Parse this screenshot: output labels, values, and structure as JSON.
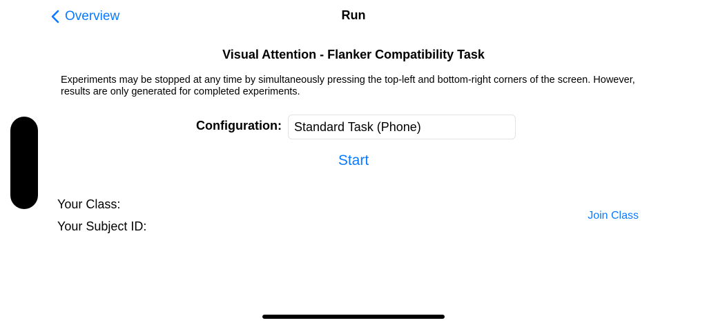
{
  "nav": {
    "back_label": "Overview",
    "title": "Run"
  },
  "task": {
    "title": "Visual Attention - Flanker Compatibility Task",
    "description": "Experiments may be stopped at any time by simultaneously pressing the top-left and bottom-right corners of the screen. However, results are only generated for completed experiments."
  },
  "configuration": {
    "label": "Configuration:",
    "value": "Standard Task (Phone)"
  },
  "start_label": "Start",
  "class_info": {
    "class_label": "Your Class:",
    "subject_label": "Your Subject ID:",
    "join_label": "Join Class"
  },
  "colors": {
    "accent": "#0a7aff",
    "text": "#000000",
    "background": "#ffffff"
  },
  "icons": {
    "back": "chevron-left-icon"
  }
}
